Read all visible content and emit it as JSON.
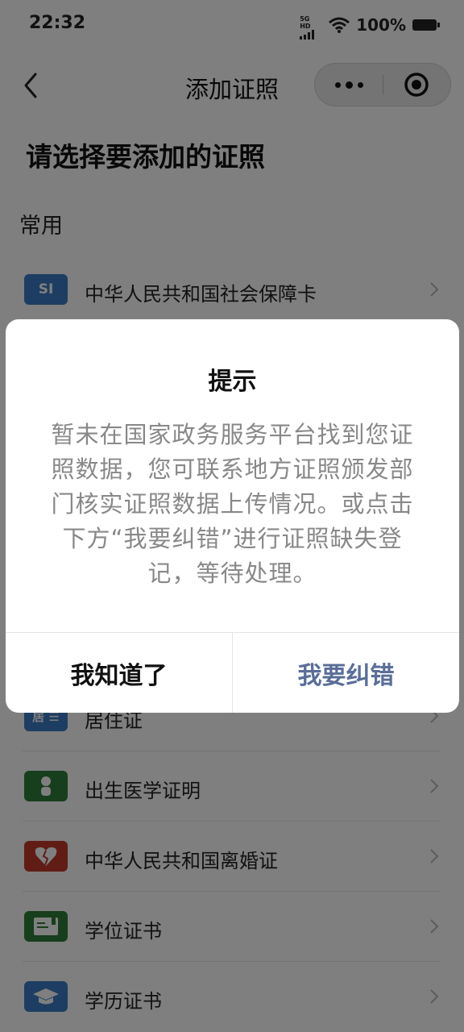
{
  "status_bar": {
    "time": "22:32",
    "network_label": "5G HD",
    "battery_percent": "100%",
    "icons": [
      "signal-icon",
      "wifi-icon",
      "battery-icon"
    ]
  },
  "nav": {
    "title": "添加证照",
    "back_icon": "back-arrow-icon",
    "more_icon": "more-dots-icon",
    "close_icon": "target-close-icon"
  },
  "page": {
    "heading": "请选择要添加的证照",
    "section_label": "常用"
  },
  "licenses": [
    {
      "label": "中华人民共和国社会保障卡",
      "icon": "social-security-card-icon",
      "icon_text": "SI",
      "color": "#3a7cc4"
    },
    {
      "label": "居住证",
      "icon": "residence-permit-icon",
      "icon_text": "居 ☰",
      "color": "#3a7cc4"
    },
    {
      "label": "出生医学证明",
      "icon": "baby-icon",
      "icon_text": "",
      "color": "#2f7d3b"
    },
    {
      "label": "中华人民共和国离婚证",
      "icon": "broken-heart-icon",
      "icon_text": "",
      "color": "#c0392b"
    },
    {
      "label": "学位证书",
      "icon": "certificate-icon",
      "icon_text": "",
      "color": "#2f7d3b"
    },
    {
      "label": "学历证书",
      "icon": "graduation-cap-icon",
      "icon_text": "",
      "color": "#3a7cc4"
    }
  ],
  "dialog": {
    "title": "提示",
    "message": "暂未在国家政务服务平台找到您证照数据，您可联系地方证照颁发部门核实证照数据上传情况。或点击下方“我要纠错”进行证照缺失登记，等待处理。",
    "confirm_label": "我知道了",
    "report_label": "我要纠错",
    "report_color": "#5a6e98"
  }
}
